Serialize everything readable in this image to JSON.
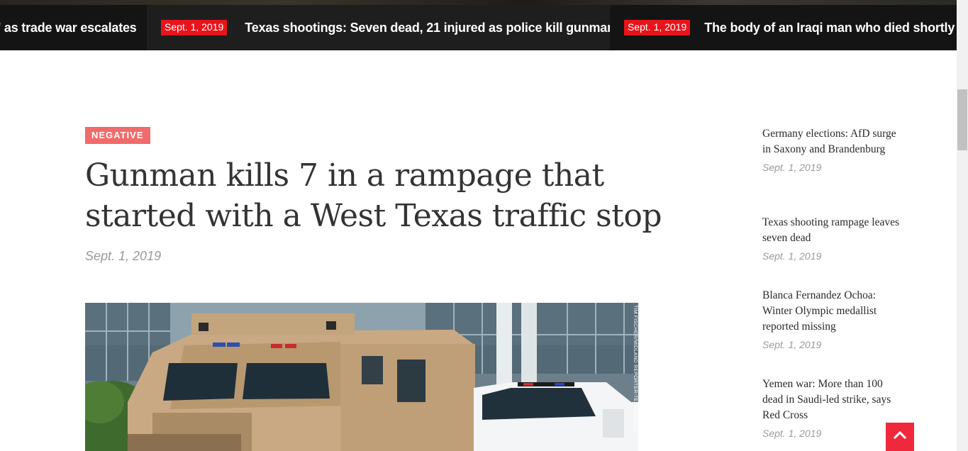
{
  "ticker": {
    "items": [
      {
        "date": "",
        "title": "' as trade war escalates"
      },
      {
        "date": "Sept. 1, 2019",
        "title": "Texas shootings: Seven dead, 21 injured as police kill gunman"
      },
      {
        "date": "Sept. 1, 2019",
        "title": "The body of an Iraqi man who died shortly af"
      }
    ]
  },
  "article": {
    "tag": "NEGATIVE",
    "headline": "Gunman kills 7 in a rampage that started with a West Texas traffic stop",
    "date": "Sept. 1, 2019",
    "image_credit": "TIM FISCHER/MIDLAND REPORTER-TELEGRAM/AP"
  },
  "sidebar": {
    "items": [
      {
        "title": "Germany elections: AfD surge in Saxony and Brandenburg",
        "date": "Sept. 1, 2019"
      },
      {
        "title": "Texas shooting rampage leaves seven dead",
        "date": "Sept. 1, 2019"
      },
      {
        "title": "Blanca Fernandez Ochoa: Winter Olympic medallist reported missing",
        "date": "Sept. 1, 2019"
      },
      {
        "title": "Yemen war: More than 100 dead in Saudi-led strike, says Red Cross",
        "date": "Sept. 1, 2019"
      }
    ]
  },
  "icons": {
    "back_to_top": "chevron-up-icon"
  },
  "colors": {
    "ticker_date_bg": "#e8141b",
    "tag_bg": "#f06b6b",
    "back_to_top_bg": "#f0283c"
  }
}
